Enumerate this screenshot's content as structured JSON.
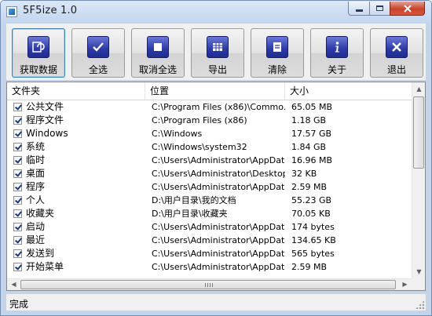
{
  "window": {
    "title": "5F5ize 1.0",
    "controls": {
      "minimize": "minimize",
      "maximize": "maximize",
      "close": "close"
    }
  },
  "toolbar": {
    "buttons": [
      {
        "label": "获取数据",
        "icon": "refresh-icon"
      },
      {
        "label": "全选",
        "icon": "checkmark-icon"
      },
      {
        "label": "取消全选",
        "icon": "stop-square-icon"
      },
      {
        "label": "导出",
        "icon": "export-icon"
      },
      {
        "label": "清除",
        "icon": "clear-document-icon"
      },
      {
        "label": "关于",
        "icon": "info-icon"
      },
      {
        "label": "退出",
        "icon": "close-x-icon"
      }
    ]
  },
  "list": {
    "columns": [
      "文件夹",
      "位置",
      "大小"
    ],
    "rows": [
      {
        "name": "公共文件",
        "location": "C:\\Program Files (x86)\\Commo...",
        "size": "65.05 MB"
      },
      {
        "name": "程序文件",
        "location": "C:\\Program Files (x86)",
        "size": "1.18 GB"
      },
      {
        "name": "Windows",
        "location": "C:\\Windows",
        "size": "17.57 GB"
      },
      {
        "name": "系统",
        "location": "C:\\Windows\\system32",
        "size": "1.84 GB"
      },
      {
        "name": "临时",
        "location": "C:\\Users\\Administrator\\AppDat...",
        "size": "16.96 MB"
      },
      {
        "name": "桌面",
        "location": "C:\\Users\\Administrator\\Desktop",
        "size": "32 KB"
      },
      {
        "name": "程序",
        "location": "C:\\Users\\Administrator\\AppDat...",
        "size": "2.59 MB"
      },
      {
        "name": "个人",
        "location": "D:\\用户目录\\我的文档",
        "size": "55.23 GB"
      },
      {
        "name": "收藏夹",
        "location": "D:\\用户目录\\收藏夹",
        "size": "70.05 KB"
      },
      {
        "name": "启动",
        "location": "C:\\Users\\Administrator\\AppDat...",
        "size": "174 bytes"
      },
      {
        "name": "最近",
        "location": "C:\\Users\\Administrator\\AppDat...",
        "size": "134.65 KB"
      },
      {
        "name": "发送到",
        "location": "C:\\Users\\Administrator\\AppDat...",
        "size": "565 bytes"
      },
      {
        "name": "开始菜单",
        "location": "C:\\Users\\Administrator\\AppDat...",
        "size": "2.59 MB"
      }
    ]
  },
  "status": {
    "text": "完成"
  }
}
